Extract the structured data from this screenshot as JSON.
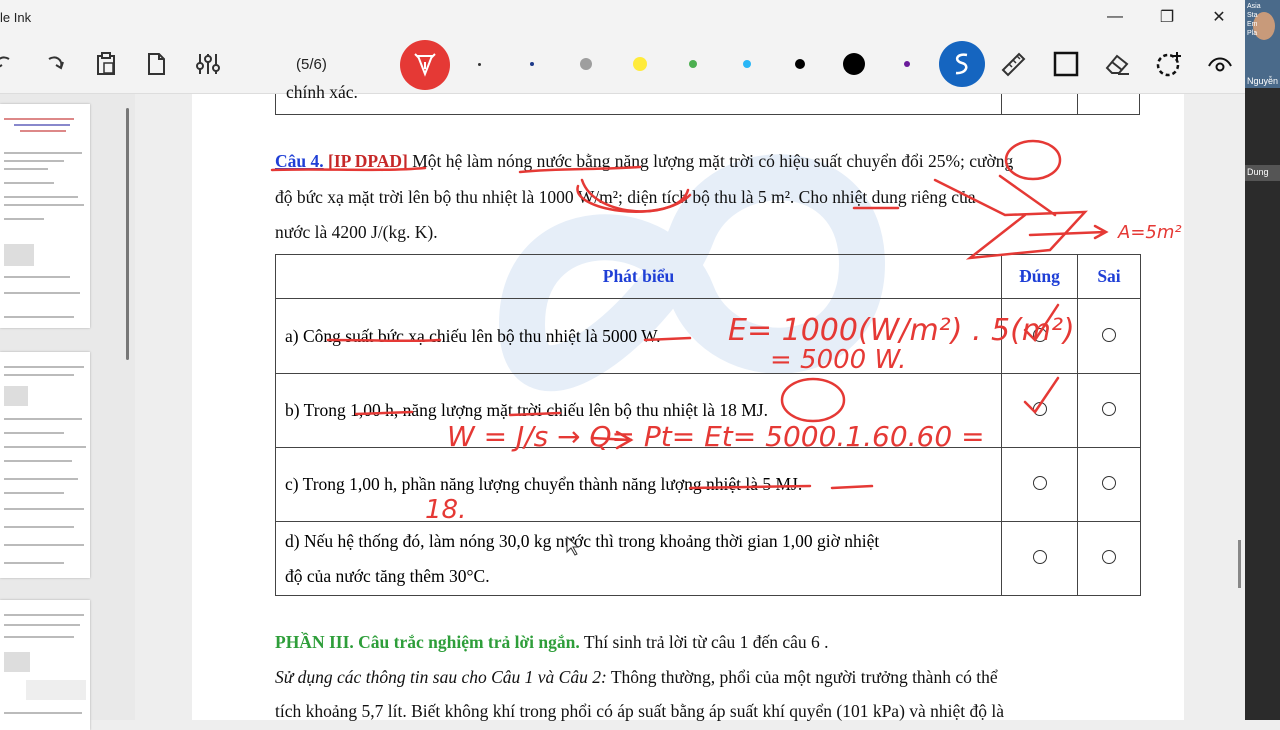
{
  "window": {
    "title": "le Ink",
    "minimize": "—",
    "maximize": "❐",
    "close": "✕"
  },
  "toolbar": {
    "page_indicator": "(5/6)"
  },
  "colors": {
    "pen_red": "#e53935",
    "pen_yellow": "#ffeb3b",
    "pen_green": "#4caf50",
    "pen_cyan": "#29b6f6",
    "pen_purple": "#6a1b9a",
    "pen_black": "#000000",
    "active_blue": "#1565c0"
  },
  "video": {
    "name": "Nguyễn",
    "label": "Dung",
    "banner_lines": [
      "Asia",
      "Sta",
      "Em",
      "Pla"
    ]
  },
  "prev_row_text": "chính xác.",
  "question": {
    "label": "Câu 4.",
    "tag": "[IP DPAD]",
    "line1": "Một hệ làm nóng nước bằng năng lượng mặt trời có hiệu suất chuyển đổi 25%; cường",
    "line2": "độ bức xạ mặt trời lên bộ thu nhiệt là 1000 W/m²; diện tích bộ thu là 5 m². Cho nhiệt dung riêng của",
    "line3": "nước là 4200 J/(kg. K)."
  },
  "table": {
    "header": {
      "statement": "Phát biểu",
      "true": "Đúng",
      "false": "Sai"
    },
    "rows": [
      {
        "text": "a) Công suất bức xạ chiếu lên bộ thu nhiệt là 5000 W."
      },
      {
        "text": "b) Trong 1,00 h, năng lượng mặt trời chiếu lên bộ thu nhiệt là 18 MJ."
      },
      {
        "text": "c) Trong 1,00 h, phần năng lượng chuyển thành năng lượng nhiệt là 5 MJ."
      },
      {
        "text": "d) Nếu hệ thống đó, làm nóng 30,0 kg nước thì trong khoảng thời gian 1,00 giờ nhiệt",
        "text2": "độ của nước tăng thêm 30°C."
      }
    ]
  },
  "part3": {
    "heading": "PHẦN III. Câu trắc nghiệm trả lời ngắn.",
    "rest": " Thí sinh trả lời từ câu 1 đến câu 6 .",
    "italic": "Sử dụng các thông tin sau cho Câu 1 và Câu 2:",
    "line1": " Thông thường, phổi của một người trưởng thành có thể",
    "line2": "tích khoảng 5,7 lít. Biết không khí trong phổi có áp suất bằng áp suất khí quyển (101 kPa) và nhiệt độ là"
  },
  "annotations": {
    "e_formula": "E= 1000(W/m²) . 5(m²)",
    "e_result": "= 5000 W.",
    "b_line": "W = J/s  →  Q= Pt= Et= 5000.1.60.60 =",
    "c_note": "18.",
    "area_note": "A=5m²"
  }
}
